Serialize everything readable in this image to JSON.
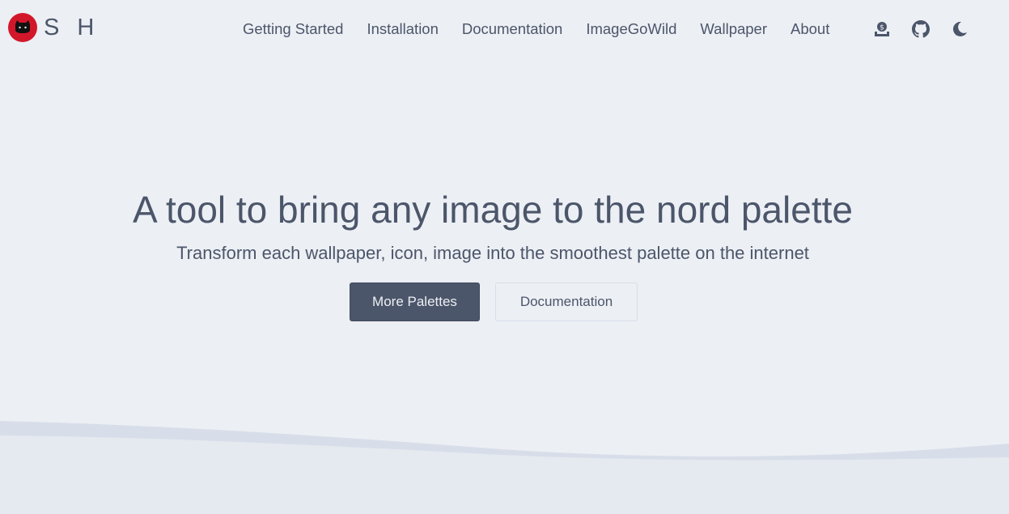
{
  "brand": {
    "text": "S H",
    "logo_icon": "cat-face-icon",
    "logo_color": "#d3172b"
  },
  "nav": {
    "links": [
      "Getting Started",
      "Installation",
      "Documentation",
      "ImageGoWild",
      "Wallpaper",
      "About"
    ],
    "icons": [
      "donate-icon",
      "github-icon",
      "moon-icon"
    ]
  },
  "hero": {
    "title": "A tool to bring any image to the nord palette",
    "subtitle": "Transform each wallpaper, icon, image into the smoothest palette on the internet",
    "primary_button": "More Palettes",
    "secondary_button": "Documentation"
  },
  "colors": {
    "background": "#eceff4",
    "text": "#4c566a",
    "primary_button_bg": "#4c566a",
    "wave": "#d8dee9",
    "footer_bg": "#e5e9f0"
  }
}
